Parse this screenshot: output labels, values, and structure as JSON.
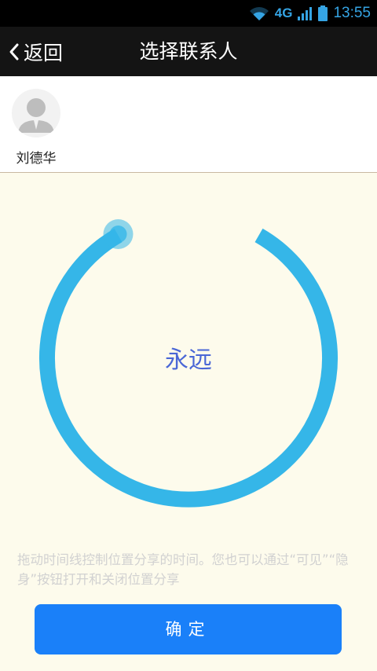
{
  "status_bar": {
    "network": "4G",
    "time": "13:55",
    "icons": [
      "wifi-icon",
      "signal-icon",
      "battery-icon"
    ]
  },
  "nav": {
    "back_label": "返回",
    "title": "选择联系人",
    "icons": [
      "chevron-left-icon"
    ]
  },
  "contacts": [
    {
      "name": "刘德华",
      "icon": "avatar-icon"
    }
  ],
  "dial": {
    "value": "永远"
  },
  "hint": "拖动时间线控制位置分享的时间。您也可以通过“可见”“隐身”按钮打开和关闭位置分享",
  "confirm_label": "确定",
  "colors": {
    "accent": "#35b6e8",
    "button": "#1a80f9",
    "dial_text": "#4a67d6",
    "background": "#fdfbec"
  }
}
